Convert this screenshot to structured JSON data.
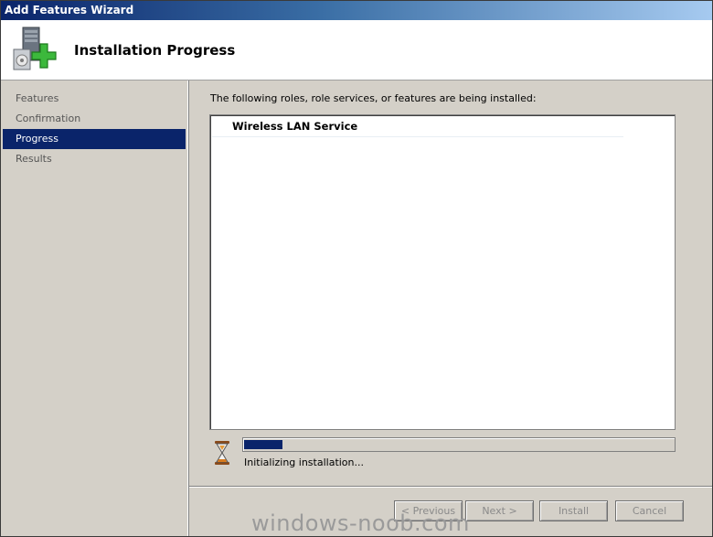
{
  "window": {
    "title": "Add Features Wizard"
  },
  "header": {
    "title": "Installation Progress",
    "icon": "server-add-icon"
  },
  "nav": {
    "items": [
      {
        "label": "Features",
        "state": "done"
      },
      {
        "label": "Confirmation",
        "state": "done"
      },
      {
        "label": "Progress",
        "state": "active"
      },
      {
        "label": "Results",
        "state": "pending"
      }
    ]
  },
  "main": {
    "intro": "The following roles, role services, or features are being installed:",
    "list": [
      "Wireless LAN Service"
    ],
    "progress_fraction": 0.09,
    "status": "Initializing installation..."
  },
  "buttons": {
    "previous": "< Previous",
    "next": "Next >",
    "install": "Install",
    "cancel": "Cancel"
  },
  "watermark": "windows-noob.com",
  "colors": {
    "selection": "#0a246a",
    "titlebar_start": "#0a246a",
    "titlebar_end": "#a6caf0"
  }
}
